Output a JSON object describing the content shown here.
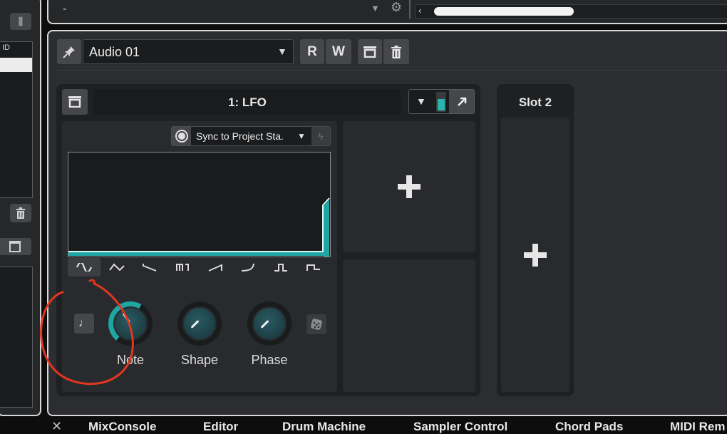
{
  "top": {
    "field_value": "-"
  },
  "left_panel": {
    "column_header": "ID"
  },
  "track": {
    "name": "Audio 01",
    "read_label": "R",
    "write_label": "W"
  },
  "modulator": {
    "slot1_title": "1: LFO",
    "slot2_title": "Slot 2",
    "sync_mode": "Sync to Project Sta.",
    "waveforms": [
      "sine",
      "triangle",
      "ramp-down",
      "square",
      "ramp-up",
      "log-curve",
      "pulse",
      "step"
    ],
    "knobs": [
      {
        "label": "Note"
      },
      {
        "label": "Shape"
      },
      {
        "label": "Phase"
      }
    ]
  },
  "colors": {
    "accent": "#2bb3b0",
    "annotation": "#e2361f"
  },
  "bottom_tabs": [
    "MixConsole",
    "Editor",
    "Drum Machine",
    "Sampler Control",
    "Chord Pads",
    "MIDI Rem"
  ]
}
